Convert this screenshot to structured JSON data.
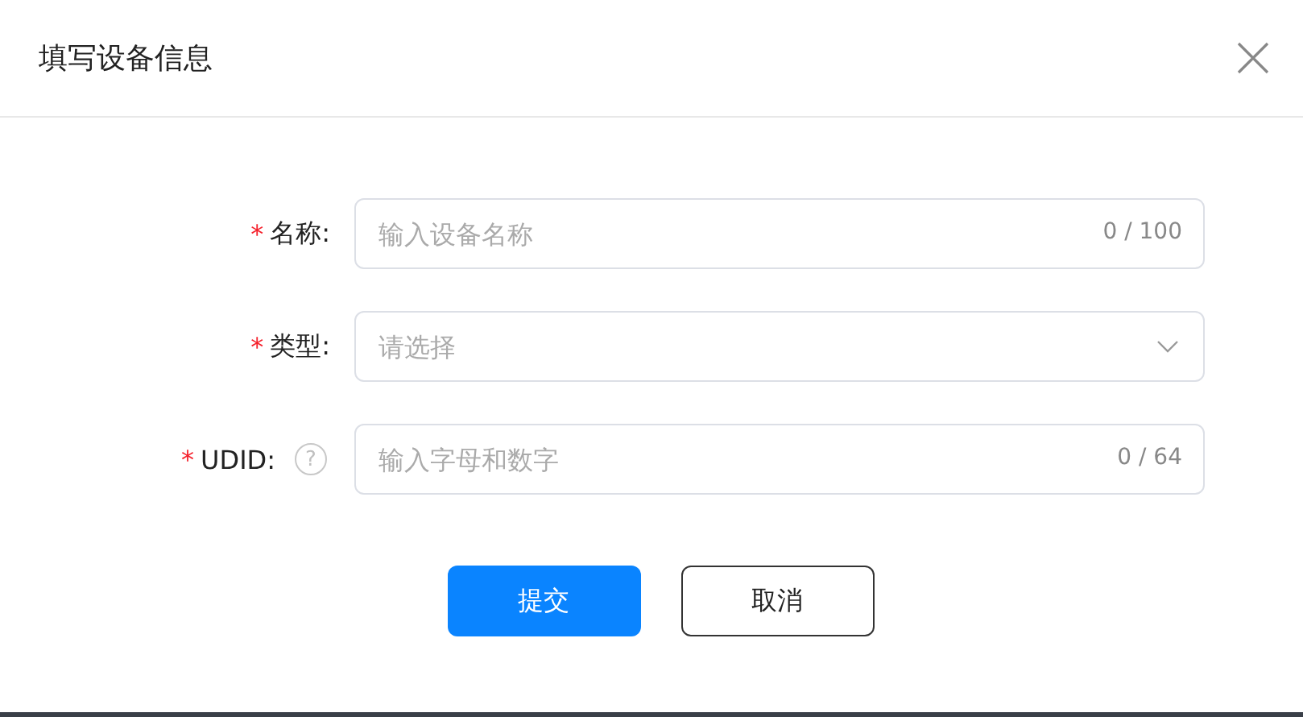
{
  "dialog": {
    "title": "填写设备信息"
  },
  "form": {
    "required_mark": "*",
    "fields": [
      {
        "kind": "text",
        "label": "名称:",
        "required": true,
        "help": false,
        "placeholder": "输入设备名称",
        "counter": "0 / 100"
      },
      {
        "kind": "select",
        "label": "类型:",
        "required": true,
        "help": false,
        "placeholder": "请选择"
      },
      {
        "kind": "text",
        "label": "UDID:",
        "required": true,
        "help": true,
        "help_glyph": "?",
        "placeholder": "输入字母和数字",
        "counter": "0 / 64"
      }
    ]
  },
  "buttons": [
    {
      "kind": "primary",
      "label": "提交"
    },
    {
      "kind": "default",
      "label": "取消"
    }
  ]
}
